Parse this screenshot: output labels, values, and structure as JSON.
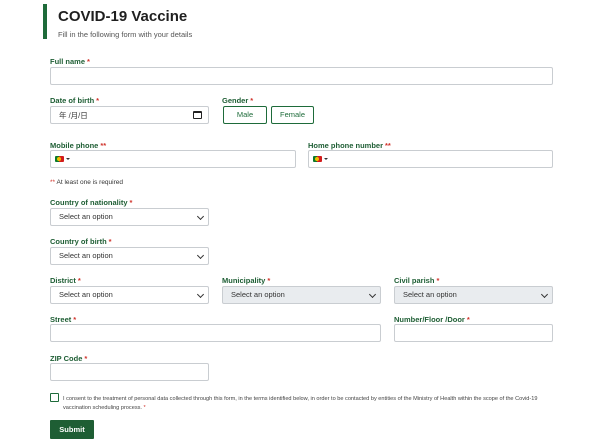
{
  "header": {
    "title": "COVID-19 Vaccine",
    "subtitle": "Fill in the following form with your details"
  },
  "fields": {
    "full_name": {
      "label": "Full name",
      "req": "*",
      "value": ""
    },
    "dob": {
      "label": "Date of birth",
      "req": "*",
      "value": "年 /月/日"
    },
    "gender": {
      "label": "Gender",
      "req": "*",
      "options": [
        "Male",
        "Female"
      ]
    },
    "mobile_phone": {
      "label": "Mobile phone",
      "req": "**",
      "value": ""
    },
    "home_phone": {
      "label": "Home phone number",
      "req": "**",
      "value": ""
    },
    "nationality": {
      "label": "Country of nationality",
      "req": "*",
      "selected": "Select an option"
    },
    "birth_country": {
      "label": "Country of birth",
      "req": "*",
      "selected": "Select an option"
    },
    "district": {
      "label": "District",
      "req": "*",
      "selected": "Select an option"
    },
    "municipality": {
      "label": "Municipality",
      "req": "*",
      "selected": "Select an option"
    },
    "civil_parish": {
      "label": "Civil parish",
      "req": "*",
      "selected": "Select an option"
    },
    "street": {
      "label": "Street",
      "req": "*",
      "value": ""
    },
    "number_floor_door": {
      "label": "Number/Floor /Door",
      "req": "*",
      "value": ""
    },
    "zip": {
      "label": "ZIP Code",
      "req": "*",
      "value": ""
    }
  },
  "phone_note": {
    "req": "**",
    "text": "At least one is required"
  },
  "consent": {
    "text": "I consent to the treatment of personal data collected through this form, in the terms identified below, in order to be contacted by entities of the Ministry of Health within the scope of the Covid-19 vaccination scheduling process.",
    "req": "*",
    "checked": false
  },
  "submit_label": "Submit",
  "colors": {
    "brand_green": "#1e5e34",
    "required_red": "#d0342c",
    "field_border": "#c9cdd1",
    "disabled_bg": "#e9ecef"
  },
  "icons": {
    "date": "calendar-icon",
    "select": "chevron-down-icon",
    "phone_prefix": "portugal-flag-icon"
  }
}
